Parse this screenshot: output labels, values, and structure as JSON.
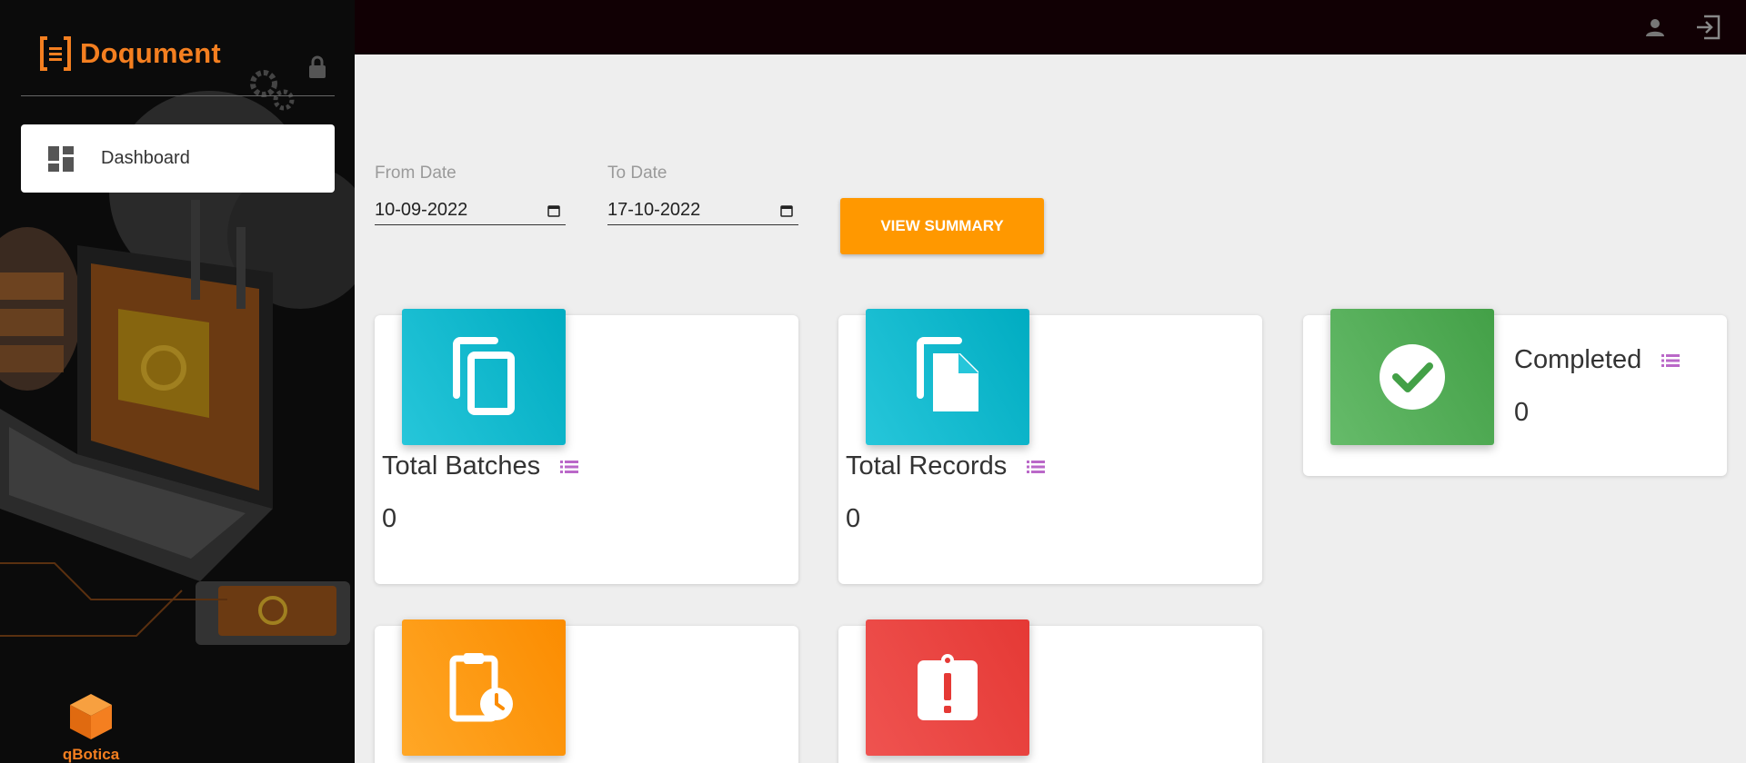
{
  "app": {
    "name": "Doqument",
    "footer_brand": "qBotica"
  },
  "sidebar": {
    "items": [
      {
        "label": "Dashboard",
        "icon": "dashboard-icon",
        "active": true
      }
    ]
  },
  "topbar": {
    "icons": [
      "user-icon",
      "logout-icon"
    ]
  },
  "filters": {
    "from_label": "From Date",
    "from_value": "10-09-2022",
    "to_label": "To Date",
    "to_value": "17-10-2022",
    "button_label": "VIEW SUMMARY"
  },
  "cards": [
    {
      "title": "Total Batches",
      "value": "0",
      "icon": "copy-icon",
      "color": "#00acc1"
    },
    {
      "title": "Total Records",
      "value": "0",
      "icon": "file-copy-icon",
      "color": "#00acc1"
    },
    {
      "title": "Completed",
      "value": "0",
      "icon": "check-circle-icon",
      "color": "#43a047"
    },
    {
      "title": "",
      "value": "",
      "icon": "clipboard-clock-icon",
      "color": "#fb8c00"
    },
    {
      "title": "",
      "value": "",
      "icon": "clipboard-alert-icon",
      "color": "#e53935"
    }
  ],
  "colors": {
    "accent": "#ff9800",
    "brand": "#f47f20",
    "list_icon": "#ba68c8"
  }
}
